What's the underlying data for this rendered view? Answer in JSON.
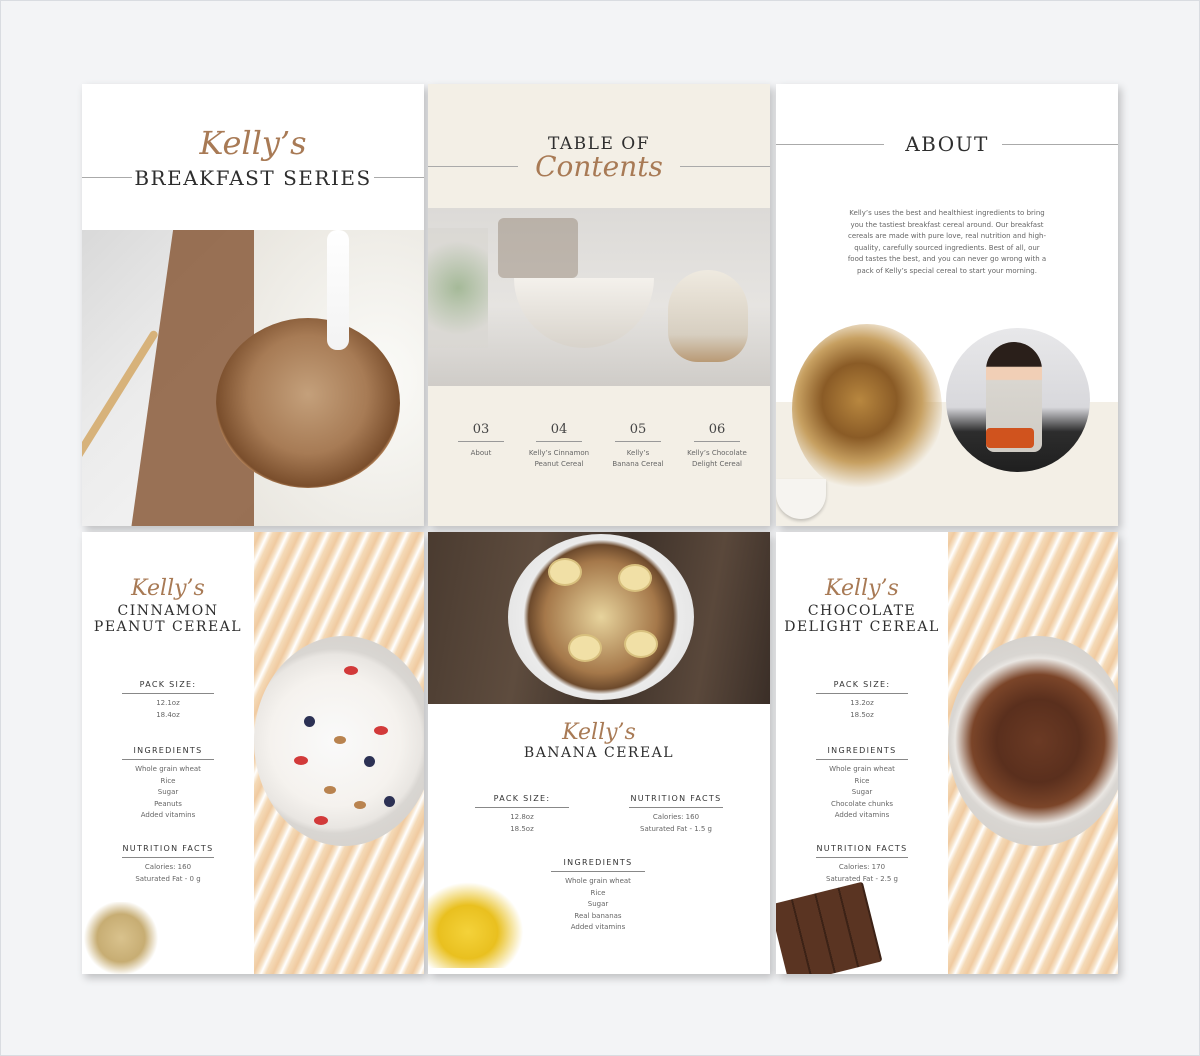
{
  "page1": {
    "script_title": "Kelly’s",
    "caps_title": "BREAKFAST SERIES"
  },
  "page2": {
    "caps_title": "TABLE OF",
    "script_title": "Contents",
    "toc": [
      {
        "num": "03",
        "line1": "About",
        "line2": ""
      },
      {
        "num": "04",
        "line1": "Kelly’s Cinnamon",
        "line2": "Peanut Cereal"
      },
      {
        "num": "05",
        "line1": "Kelly’s",
        "line2": "Banana Cereal"
      },
      {
        "num": "06",
        "line1": "Kelly’s Chocolate",
        "line2": "Delight Cereal"
      }
    ]
  },
  "page3": {
    "caps_title": "ABOUT",
    "about_text": "Kelly’s uses the best and healthiest ingredients to bring you the tastiest breakfast cereal around. Our breakfast cereals are made with pure love, real nutrition and high-quality, carefully sourced ingredients. Best of all, our food tastes the best, and you can never go wrong with a pack of Kelly’s special cereal to start your morning."
  },
  "page4": {
    "script_title": "Kelly’s",
    "caps_line1": "CINNAMON",
    "caps_line2": "PEANUT CEREAL",
    "pack_label": "PACK SIZE:",
    "pack": [
      "12.1oz",
      "18.4oz"
    ],
    "ingredients_label": "INGREDIENTS",
    "ingredients": [
      "Whole grain wheat",
      "Rice",
      "Sugar",
      "Peanuts",
      "Added vitamins"
    ],
    "nutrition_label": "NUTRITION FACTS",
    "nutrition": [
      "Calories: 160",
      "Saturated Fat - 0 g"
    ]
  },
  "page5": {
    "script_title": "Kelly’s",
    "caps_title": "BANANA CEREAL",
    "pack_label": "PACK SIZE:",
    "pack": [
      "12.8oz",
      "18.5oz"
    ],
    "nutrition_label": "NUTRITION FACTS",
    "nutrition": [
      "Calories: 160",
      "Saturated Fat - 1.5 g"
    ],
    "ingredients_label": "INGREDIENTS",
    "ingredients": [
      "Whole grain wheat",
      "Rice",
      "Sugar",
      "Real bananas",
      "Added vitamins"
    ]
  },
  "page6": {
    "script_title": "Kelly’s",
    "caps_line1": "CHOCOLATE",
    "caps_line2": "DELIGHT CEREAL",
    "pack_label": "PACK SIZE:",
    "pack": [
      "13.2oz",
      "18.5oz"
    ],
    "ingredients_label": "INGREDIENTS",
    "ingredients": [
      "Whole grain wheat",
      "Rice",
      "Sugar",
      "Chocolate chunks",
      "Added vitamins"
    ],
    "nutrition_label": "NUTRITION FACTS",
    "nutrition": [
      "Calories: 170",
      "Saturated Fat - 2.5 g"
    ]
  },
  "colors": {
    "accent_script": "#a87a55",
    "beige": "#f3efe6",
    "text_dark": "#2e2e2e"
  }
}
